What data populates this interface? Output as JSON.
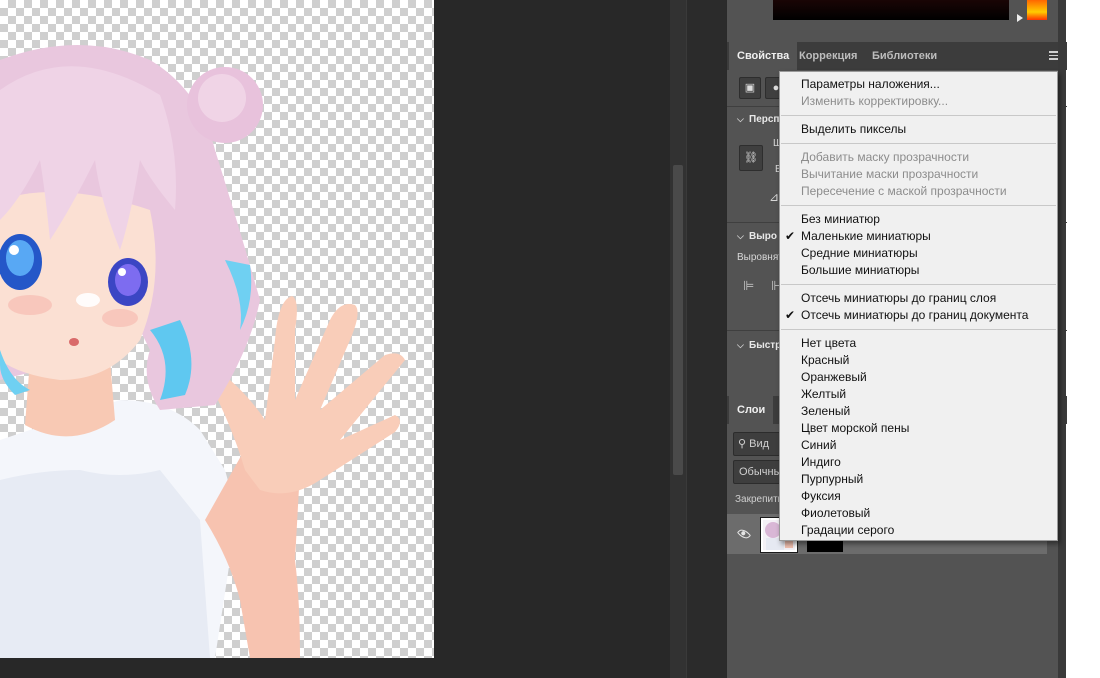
{
  "panel": {
    "tabs": [
      {
        "label": "Свойства",
        "active": true
      },
      {
        "label": "Коррекция",
        "active": false
      },
      {
        "label": "Библиотеки",
        "active": false
      }
    ],
    "sections": [
      {
        "title": "Персп"
      },
      {
        "title": "Выро"
      },
      {
        "title": "Быстр"
      }
    ],
    "fragments": {
      "w_label": "Ш",
      "h_label": "В",
      "align_label": "Выровнят"
    }
  },
  "layers": {
    "tab_label": "Слои",
    "search_placeholder": "Вид",
    "blend_mode": "Обычны",
    "lock_label": "Закрепить"
  },
  "context_menu": {
    "groups": [
      [
        {
          "label": "Параметры наложения...",
          "enabled": true,
          "checked": false
        },
        {
          "label": "Изменить корректировку...",
          "enabled": false,
          "checked": false
        }
      ],
      [
        {
          "label": "Выделить пикселы",
          "enabled": true,
          "checked": false
        }
      ],
      [
        {
          "label": "Добавить маску прозрачности",
          "enabled": false,
          "checked": false
        },
        {
          "label": "Вычитание маски прозрачности",
          "enabled": false,
          "checked": false
        },
        {
          "label": "Пересечение с маской прозрачности",
          "enabled": false,
          "checked": false
        }
      ],
      [
        {
          "label": "Без миниатюр",
          "enabled": true,
          "checked": false
        },
        {
          "label": "Маленькие миниатюры",
          "enabled": true,
          "checked": true
        },
        {
          "label": "Средние миниатюры",
          "enabled": true,
          "checked": false
        },
        {
          "label": "Большие миниатюры",
          "enabled": true,
          "checked": false
        }
      ],
      [
        {
          "label": "Отсечь миниатюры до границ слоя",
          "enabled": true,
          "checked": false
        },
        {
          "label": "Отсечь миниатюры до границ документа",
          "enabled": true,
          "checked": true
        }
      ],
      [
        {
          "label": "Нет цвета",
          "enabled": true,
          "checked": false
        },
        {
          "label": "Красный",
          "enabled": true,
          "checked": false
        },
        {
          "label": "Оранжевый",
          "enabled": true,
          "checked": false
        },
        {
          "label": "Желтый",
          "enabled": true,
          "checked": false
        },
        {
          "label": "Зеленый",
          "enabled": true,
          "checked": false
        },
        {
          "label": "Цвет морской пены",
          "enabled": true,
          "checked": false
        },
        {
          "label": "Синий",
          "enabled": true,
          "checked": false
        },
        {
          "label": "Индиго",
          "enabled": true,
          "checked": false
        },
        {
          "label": "Пурпурный",
          "enabled": true,
          "checked": false
        },
        {
          "label": "Фуксия",
          "enabled": true,
          "checked": false
        },
        {
          "label": "Фиолетовый",
          "enabled": true,
          "checked": false
        },
        {
          "label": "Градации серого",
          "enabled": true,
          "checked": false
        }
      ]
    ]
  },
  "colors": {
    "panel_bg": "#535353",
    "workspace_bg": "#282828",
    "menu_bg": "#f0f0f0"
  }
}
